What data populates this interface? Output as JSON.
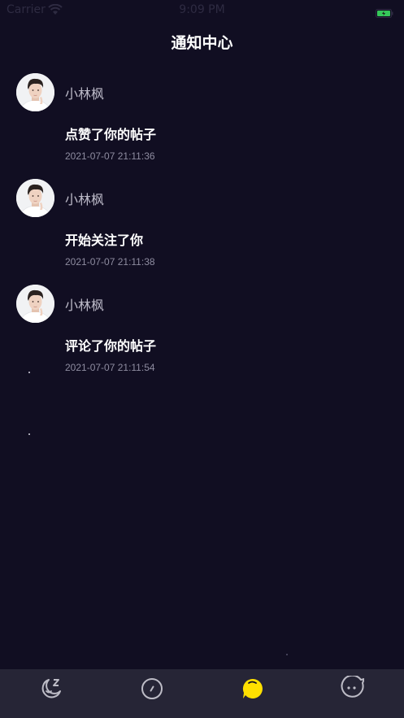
{
  "status_bar": {
    "carrier": "Carrier",
    "time": "9:09 PM"
  },
  "header": {
    "title": "通知中心"
  },
  "notifications": [
    {
      "user": "小林枫",
      "action": "点赞了你的帖子",
      "time": "2021-07-07 21:11:36"
    },
    {
      "user": "小林枫",
      "action": "开始关注了你",
      "time": "2021-07-07 21:11:38"
    },
    {
      "user": "小林枫",
      "action": "评论了你的帖子",
      "time": "2021-07-07 21:11:54"
    }
  ],
  "tab_bar": {
    "tabs": [
      {
        "icon": "sleep-moon-icon",
        "active": false
      },
      {
        "icon": "compass-icon",
        "active": false
      },
      {
        "icon": "chat-bubble-icon",
        "active": true
      },
      {
        "icon": "face-bubble-icon",
        "active": false
      }
    ],
    "active_color": "#ffe000",
    "inactive_color": "#bdbcc6"
  },
  "colors": {
    "background": "#110e22",
    "tab_bar_background": "#262536"
  }
}
